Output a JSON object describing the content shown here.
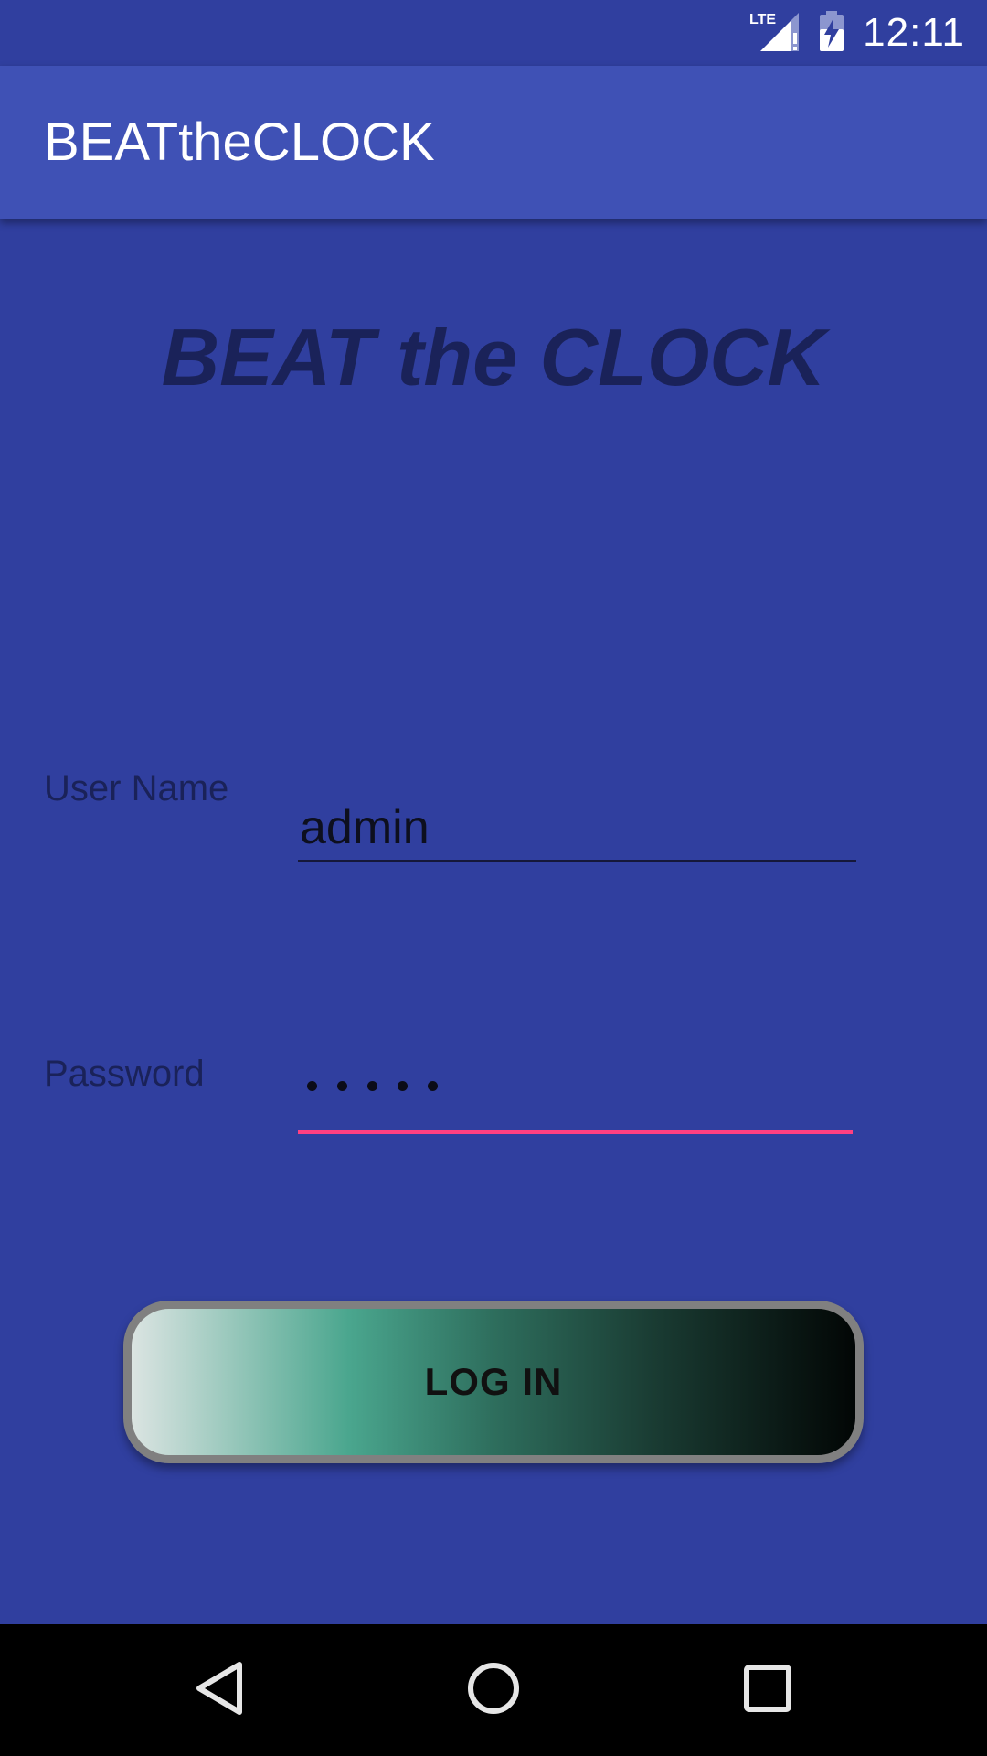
{
  "status_bar": {
    "time": "12:11",
    "network_label": "LTE",
    "icons": [
      "lte-signal-icon",
      "battery-charging-icon"
    ]
  },
  "app_bar": {
    "title": "BEATtheCLOCK"
  },
  "main": {
    "headline": "BEAT the CLOCK",
    "username": {
      "label": "User Name",
      "value": "admin"
    },
    "password": {
      "label": "Password",
      "masked_length": 5
    },
    "login_button": {
      "label": "LOG IN"
    }
  },
  "nav_bar": {
    "icons": [
      "back-icon",
      "home-icon",
      "recents-icon"
    ]
  },
  "colors": {
    "background": "#303f9f",
    "app_bar": "#3f51b5",
    "accent": "#ff4081",
    "text_dark": "#1a2259"
  }
}
